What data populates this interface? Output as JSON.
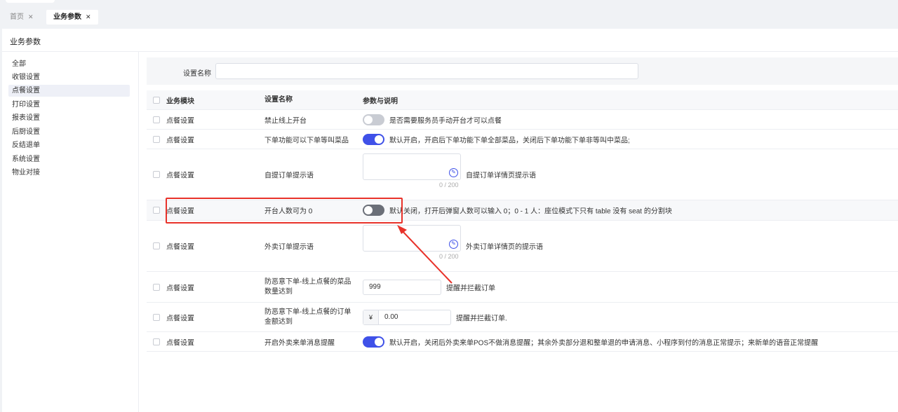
{
  "tabs": [
    {
      "label": "首页",
      "close": "✕"
    },
    {
      "label": "业务参数",
      "close": "✕"
    }
  ],
  "panel": {
    "title": "业务参数"
  },
  "sidebar": {
    "items": [
      {
        "label": "全部"
      },
      {
        "label": "收银设置"
      },
      {
        "label": "点餐设置"
      },
      {
        "label": "打印设置"
      },
      {
        "label": "报表设置"
      },
      {
        "label": "后厨设置"
      },
      {
        "label": "反结退单"
      },
      {
        "label": "系统设置"
      },
      {
        "label": "物业对接"
      }
    ],
    "active": "点餐设置"
  },
  "search": {
    "label": "设置名称",
    "value": "",
    "placeholder": ""
  },
  "table": {
    "headers": {
      "module": "业务模块",
      "name": "设置名称",
      "param": "参数与说明"
    },
    "rows": [
      {
        "module": "点餐设置",
        "name": "禁止线上开台",
        "control": "toggle-off",
        "desc": "是否需要服务员手动开台才可以点餐"
      },
      {
        "module": "点餐设置",
        "name": "下单功能可以下单等叫菜品",
        "control": "toggle-on",
        "desc": "默认开启，开启后下单功能下单全部菜品，关闭后下单功能下单非等叫中菜品;"
      },
      {
        "module": "点餐设置",
        "name": "自提订单提示语",
        "control": "textarea",
        "counter": "0 / 200",
        "desc": "自提订单详情页提示语"
      },
      {
        "module": "点餐设置",
        "name": "开台人数可为 0",
        "control": "toggle-off",
        "desc": "默认关闭，打开后弹窗人数可以输入 0；0 - 1 人：座位模式下只有 table 没有 seat 的分割块"
      },
      {
        "module": "点餐设置",
        "name": "外卖订单提示语",
        "control": "textarea",
        "counter": "0 / 200",
        "desc": "外卖订单详情页的提示语"
      },
      {
        "module": "点餐设置",
        "name": "防恶意下单-线上点餐的菜品数量达到",
        "control": "number",
        "value": "999",
        "desc": "提醒并拦截订单"
      },
      {
        "module": "点餐设置",
        "name": "防恶意下单-线上点餐的订单金额达到",
        "control": "money",
        "prefix": "¥",
        "value": "0.00",
        "desc": "提醒并拦截订单."
      },
      {
        "module": "点餐设置",
        "name": "开启外卖来单消息提醒",
        "control": "toggle-on",
        "desc": "默认开启，关闭后外卖来单POS不做消息提醒；其余外卖部分退和整单退的申请消息、小程序到付的消息正常提示；来新单的语音正常提醒"
      }
    ]
  },
  "colors": {
    "accent": "#3f51e8",
    "annotation": "#e8322a"
  }
}
